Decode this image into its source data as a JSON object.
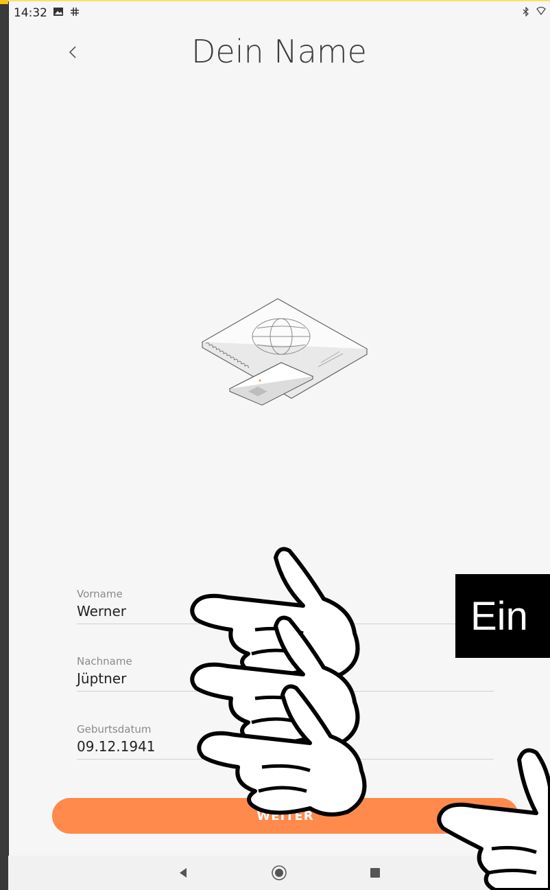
{
  "status_bar": {
    "time": "14:32"
  },
  "header": {
    "title": "Dein Name"
  },
  "form": {
    "first_name": {
      "label": "Vorname",
      "value": "Werner"
    },
    "last_name": {
      "label": "Nachname",
      "value": "Jüptner"
    },
    "birth_date": {
      "label": "Geburtsdatum",
      "value": "09.12.1941"
    }
  },
  "primary_button": {
    "label": "WEITER"
  },
  "overlay": {
    "text": "Ein"
  },
  "colors": {
    "accent": "#ff8a4c",
    "background": "#f6f6f6"
  },
  "icons": [
    "image-icon",
    "slack-icon",
    "bluetooth-icon",
    "wifi-icon",
    "back-chevron-icon",
    "passport-illustration",
    "pointing-hand-icon"
  ]
}
